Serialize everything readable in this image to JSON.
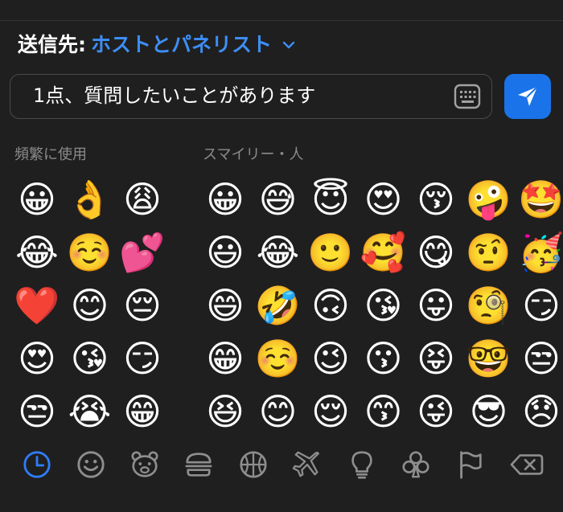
{
  "recipient": {
    "label": "送信先:",
    "value": "ホストとパネリスト"
  },
  "message": {
    "text": "1点、質問したいことがあります"
  },
  "sections": {
    "frequent": "頻繁に使用",
    "smileys": "スマイリー・人"
  },
  "frequent_emojis": [
    "😀",
    "👌",
    "😩",
    "😂",
    "☺️",
    "💕",
    "❤️",
    "😊",
    "😔",
    "😍",
    "😘",
    "😏",
    "😒",
    "😭",
    "😁"
  ],
  "smiley_emojis": [
    "😀",
    "😅",
    "😇",
    "😍",
    "😚",
    "🤪",
    "🤩",
    "😃",
    "😂",
    "🙂",
    "🥰",
    "😋",
    "🤨",
    "🥳",
    "😄",
    "🤣",
    "🙃",
    "😘",
    "😛",
    "🧐",
    "😏",
    "😁",
    "☺️",
    "😉",
    "😗",
    "😝",
    "🤓",
    "😒",
    "😆",
    "😊",
    "😌",
    "😙",
    "😜",
    "😎",
    "😞"
  ],
  "categories": [
    "recent",
    "smileys",
    "animals",
    "food",
    "activity",
    "travel",
    "objects",
    "symbols",
    "flags"
  ],
  "colors": {
    "accent": "#1a73e8",
    "link": "#3d8ef7",
    "background": "#1f1f1f",
    "icon": "#8e8e8e"
  }
}
